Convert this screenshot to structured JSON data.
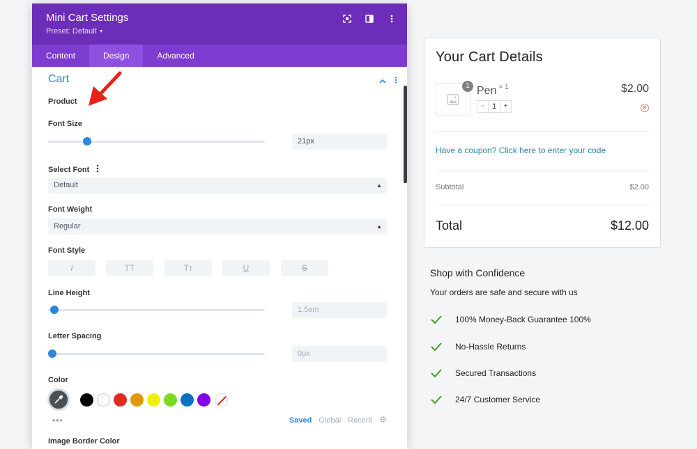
{
  "panel": {
    "title": "Mini Cart Settings",
    "preset": "Preset: Default",
    "tabs": [
      "Content",
      "Design",
      "Advanced"
    ],
    "active_tab": "Design",
    "section_title": "Cart",
    "product_label": "Product",
    "font_size": {
      "label": "Font Size",
      "value": "21px",
      "slider_fraction": 0.18
    },
    "select_font": {
      "label": "Select Font",
      "value": "Default"
    },
    "font_weight": {
      "label": "Font Weight",
      "value": "Regular"
    },
    "font_style": {
      "label": "Font Style",
      "buttons": [
        "I",
        "TT",
        "Tт",
        "U",
        "S"
      ]
    },
    "line_height": {
      "label": "Line Height",
      "value": "1.5em",
      "slider_fraction": 0.0
    },
    "letter_spacing": {
      "label": "Letter Spacing",
      "value": "0px",
      "slider_fraction": 0.0
    },
    "color": {
      "label": "Color",
      "swatches": [
        "#000000",
        "#ffffff",
        "#e02b20",
        "#e09900",
        "#edf000",
        "#7cda24",
        "#0c71c3",
        "#8300e9"
      ],
      "tabs": [
        "Saved",
        "Global",
        "Recent"
      ],
      "active_tab": "Saved"
    },
    "next_label": "Image Border Color",
    "accent": "#2b87da",
    "header_color": "#6c2eb9"
  },
  "cart": {
    "title": "Your Cart Details",
    "item": {
      "name": "Pen",
      "multiplier": "× 1",
      "badge": "1",
      "qty": "1",
      "minus": "-",
      "plus": "+",
      "price": "$2.00"
    },
    "coupon": "Have a coupon? Click here to enter your code",
    "subtotal_label": "Subtotal",
    "subtotal_value": "$2.00",
    "total_label": "Total",
    "total_value": "$12.00"
  },
  "confidence": {
    "title": "Shop with Confidence",
    "subtitle": "Your orders are safe and secure with us",
    "items": [
      "100% Money-Back Guarantee 100%",
      "No-Hassle Returns",
      "Secured Transactions",
      "24/7 Customer Service"
    ],
    "check_color": "#4a9e1f"
  }
}
